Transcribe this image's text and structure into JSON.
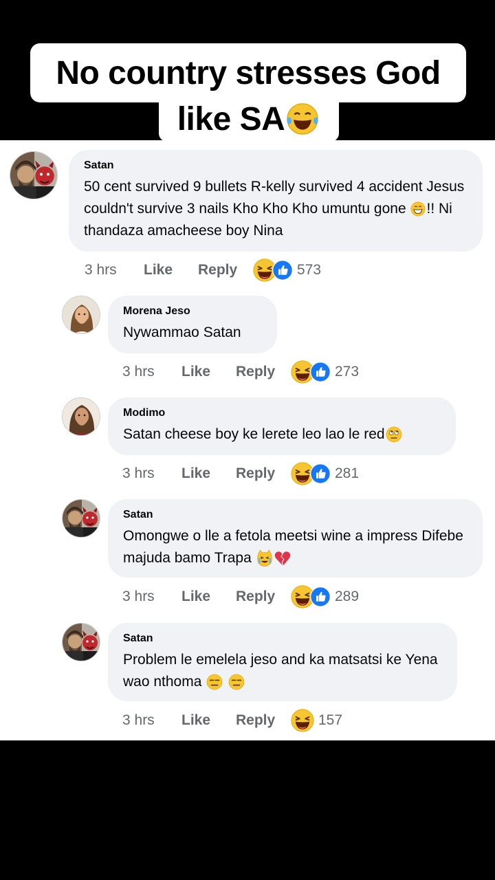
{
  "caption": {
    "line1": "No country stresses God",
    "line2": "like SA"
  },
  "comments": [
    {
      "author": "Satan",
      "text_a": "50 cent survived 9 bullets R-kelly survived 4 accident Jesus couldn't survive 3 nails Kho Kho Kho umuntu gone ",
      "text_b": "!! Ni thandaza amacheese boy Nina",
      "time": "3 hrs",
      "like": "Like",
      "reply": "Reply",
      "reactions": "573"
    },
    {
      "author": "Morena Jeso",
      "text": "Nywammao Satan",
      "time": "3 hrs",
      "like": "Like",
      "reply": "Reply",
      "reactions": "273"
    },
    {
      "author": "Modimo",
      "text": "Satan cheese boy ke lerete leo lao le red",
      "time": "3 hrs",
      "like": "Like",
      "reply": "Reply",
      "reactions": "281"
    },
    {
      "author": "Satan",
      "text": " Omongwe o lle a fetola meetsi wine a impress Difebe majuda bamo Trapa ",
      "time": "3 hrs",
      "like": "Like",
      "reply": "Reply",
      "reactions": "289"
    },
    {
      "author": "Satan",
      "text": "Problem le emelela jeso and ka matsatsi ke Yena wao nthoma ",
      "time": "3 hrs",
      "like": "Like",
      "reply": "Reply",
      "reactions": "157"
    }
  ],
  "colors": {
    "bubble": "#f0f2f5",
    "meta": "#65676b",
    "like_blue": "#1877f2",
    "haha_yellow": "#f7c531"
  },
  "icons": [
    "laughing-emoji",
    "like-thumb-icon",
    "rolling-eyes-emoji",
    "crying-cat-emoji",
    "broken-heart-emoji",
    "expressionless-emoji"
  ]
}
